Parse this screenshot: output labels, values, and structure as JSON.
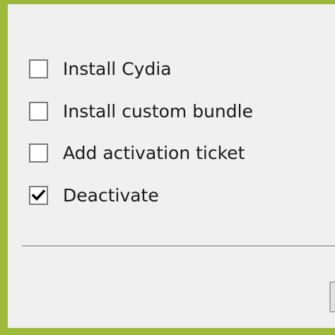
{
  "options": [
    {
      "label": "Install Cydia",
      "checked": false
    },
    {
      "label": "Install custom bundle",
      "checked": false
    },
    {
      "label": "Add activation ticket",
      "checked": false
    },
    {
      "label": "Deactivate",
      "checked": true
    }
  ],
  "colors": {
    "frame_border": "#9dbb3a",
    "panel_background": "#f0f0f0",
    "checkbox_border": "#7a7a7a"
  }
}
